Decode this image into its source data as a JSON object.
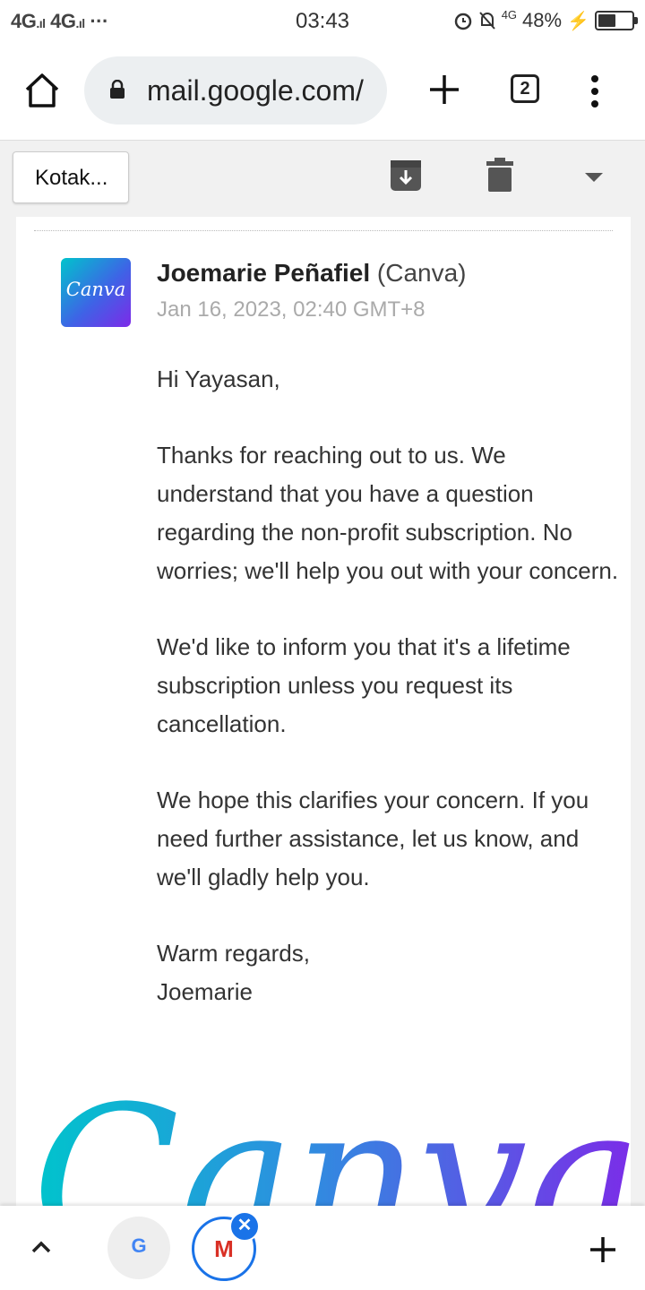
{
  "status_bar": {
    "signal_left": "4G",
    "signal_right": "4G",
    "dots": "···",
    "time": "03:43",
    "network": "4G",
    "battery": "48%",
    "battery_level": 0.48
  },
  "browser": {
    "url": "mail.google.com/",
    "tab_count": "2",
    "icons": [
      "home-icon",
      "lock-icon",
      "plus-icon",
      "tabs-icon",
      "menu-icon"
    ]
  },
  "gmail_toolbar": {
    "back_label": "Kotak...",
    "icons": [
      "archive-icon",
      "delete-icon",
      "chevron-down-icon"
    ]
  },
  "email": {
    "avatar_text": "Canva",
    "sender_name": "Joemarie Peñafiel",
    "sender_org": "(Canva)",
    "date": "Jan 16, 2023, 02:40 GMT+8",
    "greeting": "Hi Yayasan,",
    "paragraph1": "Thanks for reaching out to us. We understand that you have a question regarding the non-profit subscription. No worries; we'll help you out with your concern.",
    "paragraph2": "We'd like to inform you that it's a lifetime subscription unless you request its cancellation.",
    "paragraph3": "We hope this clarifies your concern. If you need further assistance, let us know, and we'll gladly help you.",
    "signoff": "Warm regards,",
    "signature": "Joemarie",
    "logo_text": "Canva"
  },
  "bottom_bar": {
    "google_tab": "G",
    "gmail_tab": "M",
    "close_badge": "✕",
    "icons": [
      "chevron-up-icon",
      "google-icon",
      "gmail-icon",
      "close-icon",
      "plus-icon"
    ]
  },
  "colors": {
    "accent_blue": "#1a73e8",
    "gmail_red": "#d93025",
    "canva_cyan": "#00c4cc",
    "canva_purple": "#7d2ae8"
  }
}
